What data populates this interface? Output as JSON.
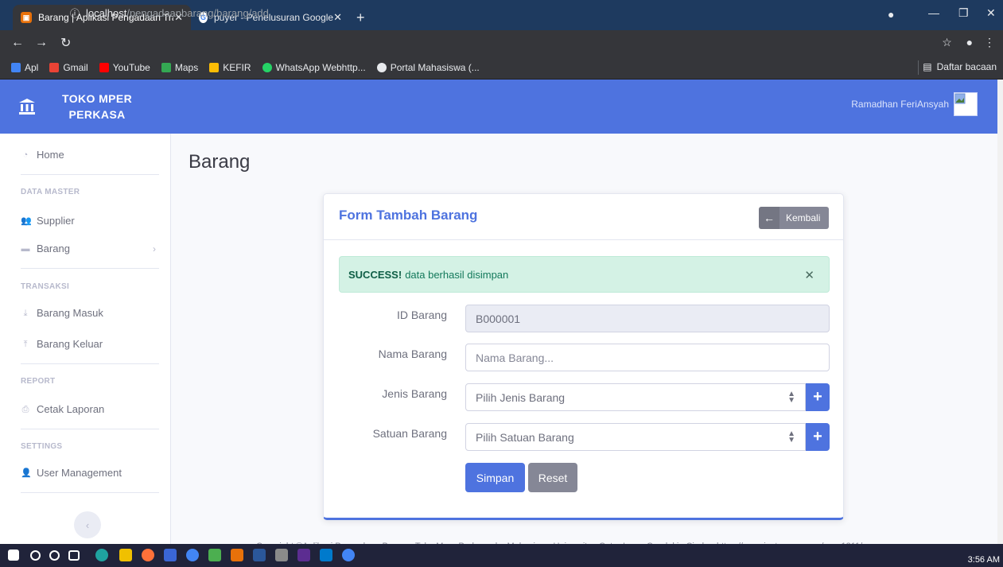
{
  "browser": {
    "tabs": [
      {
        "title": "Barang | Aplikasi Pengadaan Tran",
        "active": true
      },
      {
        "title": "puyer - Penelusuran Google",
        "active": false
      }
    ],
    "url_host": "localhost",
    "url_path": "/pengadaanbarang/barang/add",
    "bookmarks": [
      "Apl",
      "Gmail",
      "YouTube",
      "Maps",
      "KEFIR",
      "WhatsApp Webhttp...",
      "Portal Mahasiswa (..."
    ],
    "reading_list": "Daftar bacaan"
  },
  "app": {
    "brand_line1": "TOKO MPER",
    "brand_line2": "PERKASA",
    "user_name": "Ramadhan FeriAnsyah"
  },
  "sidebar": {
    "home": "Home",
    "data_master": "DATA MASTER",
    "supplier": "Supplier",
    "barang": "Barang",
    "transaksi": "TRANSAKSI",
    "barang_masuk": "Barang Masuk",
    "barang_keluar": "Barang Keluar",
    "report": "REPORT",
    "cetak_laporan": "Cetak Laporan",
    "settings": "SETTINGS",
    "user_management": "User Management"
  },
  "main": {
    "page_title": "Barang",
    "card_title": "Form Tambah Barang",
    "back_label": "Kembali",
    "alert_strong": "SUCCESS!",
    "alert_text": "data berhasil disimpan",
    "form": {
      "id_label": "ID Barang",
      "id_value": "B000001",
      "nama_label": "Nama Barang",
      "nama_placeholder": "Nama Barang...",
      "jenis_label": "Jenis Barang",
      "jenis_value": "Pilih Jenis Barang",
      "satuan_label": "Satuan Barang",
      "satuan_value": "Pilih Satuan Barang"
    },
    "save_label": "Simpan",
    "reset_label": "Reset"
  },
  "footer": "Copyright ©Aplikasi Pengadaan Barang, Toko Mper Perkasa; by Mahasiswa Universitas Catur Insan Cendekia Cirebonhttps://www.instagram.com/per_1211/",
  "taskbar": {
    "clock": "3:56 AM"
  },
  "colors": {
    "primary": "#4e73df",
    "secondary": "#858796",
    "success_bg": "#d4f2e5",
    "success_text": "#13795b"
  }
}
